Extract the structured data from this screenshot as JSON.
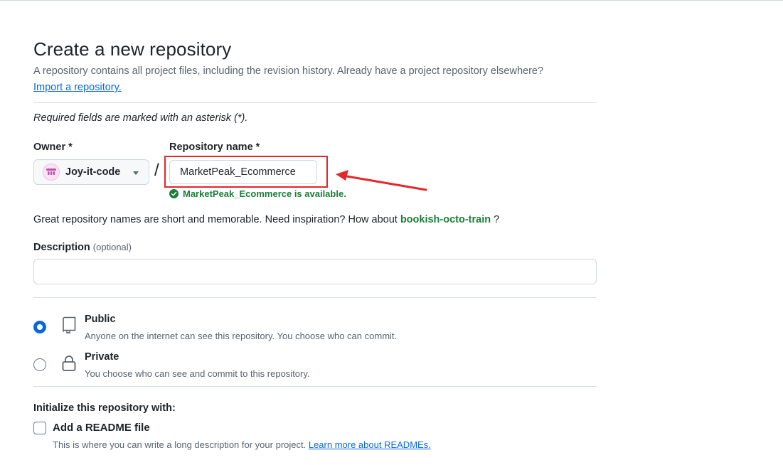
{
  "page": {
    "title": "Create a new repository",
    "subtitle": "A repository contains all project files, including the revision history. Already have a project repository elsewhere?",
    "import_link": "Import a repository.",
    "required_note": "Required fields are marked with an asterisk (*)."
  },
  "owner": {
    "label": "Owner *",
    "value": "Joy-it-code"
  },
  "separator": "/",
  "repo_name": {
    "label": "Repository name *",
    "value": "MarketPeak_Ecommerce",
    "availability": "MarketPeak_Ecommerce is available."
  },
  "suggestion": {
    "text": "Great repository names are short and memorable. Need inspiration? How about",
    "name": "bookish-octo-train",
    "suffix": "?"
  },
  "description": {
    "label": "Description",
    "optional": "(optional)",
    "value": ""
  },
  "visibility": {
    "selected": "Public",
    "options": [
      {
        "label": "Public",
        "desc": "Anyone on the internet can see this repository. You choose who can commit."
      },
      {
        "label": "Private",
        "desc": "You choose who can see and commit to this repository."
      }
    ]
  },
  "initialize": {
    "label": "Initialize this repository with:",
    "readme_label": "Add a README file",
    "readme_checked": false,
    "readme_desc": "This is where you can write a long description for your project.",
    "readme_link": "Learn more about READMEs."
  },
  "colors": {
    "annotation": "#e5262c",
    "success": "#1a7f37",
    "link": "#0969da",
    "radio_selected": "#0969da"
  },
  "icons": [
    "check-circle-icon",
    "repo-icon",
    "lock-icon",
    "caret-down-icon",
    "annotation-arrow"
  ]
}
